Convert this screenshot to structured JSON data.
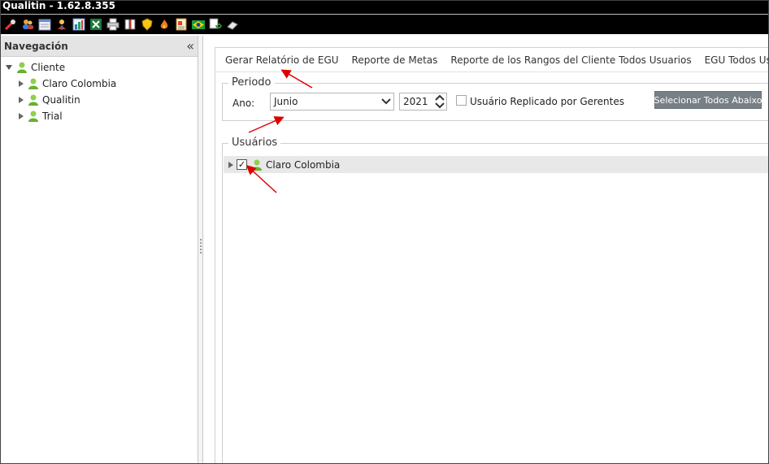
{
  "window": {
    "title": "Qualitin - 1.62.8.355"
  },
  "toolbar": {
    "icons": [
      "tools-icon",
      "users-icon",
      "calendar-icon",
      "cooking-icon",
      "chart-icon",
      "excel-icon",
      "print-icon",
      "book-icon",
      "shield-icon",
      "fire-icon",
      "report-icon",
      "brazil-flag-icon",
      "refresh-icon",
      "eraser-icon"
    ]
  },
  "navigation": {
    "title": "Navegación",
    "collapse_glyph": "«",
    "root": "Cliente",
    "items": [
      "Claro Colombia",
      "Qualitin",
      "Trial"
    ]
  },
  "tabs": [
    "Gerar Relatório de EGU",
    "Reporte de Metas",
    "Reporte de los Rangos del Cliente Todos Usuarios",
    "EGU Todos Usuarios"
  ],
  "periodo": {
    "legend": "Periodo",
    "ano_label": "Ano:",
    "month": "Junio",
    "year": "2021",
    "replicado_label": "Usuário Replicado por Gerentes",
    "select_all_button": "Selecionar Todos Abaixo"
  },
  "usuarios": {
    "legend": "Usuários",
    "rows": [
      {
        "label": "Claro Colombia",
        "checked": true
      }
    ]
  },
  "colors": {
    "titlebar": "#000000",
    "button": "#777f87",
    "annotation_arrow": "#e00000",
    "user_icon": "#7cc43a"
  }
}
